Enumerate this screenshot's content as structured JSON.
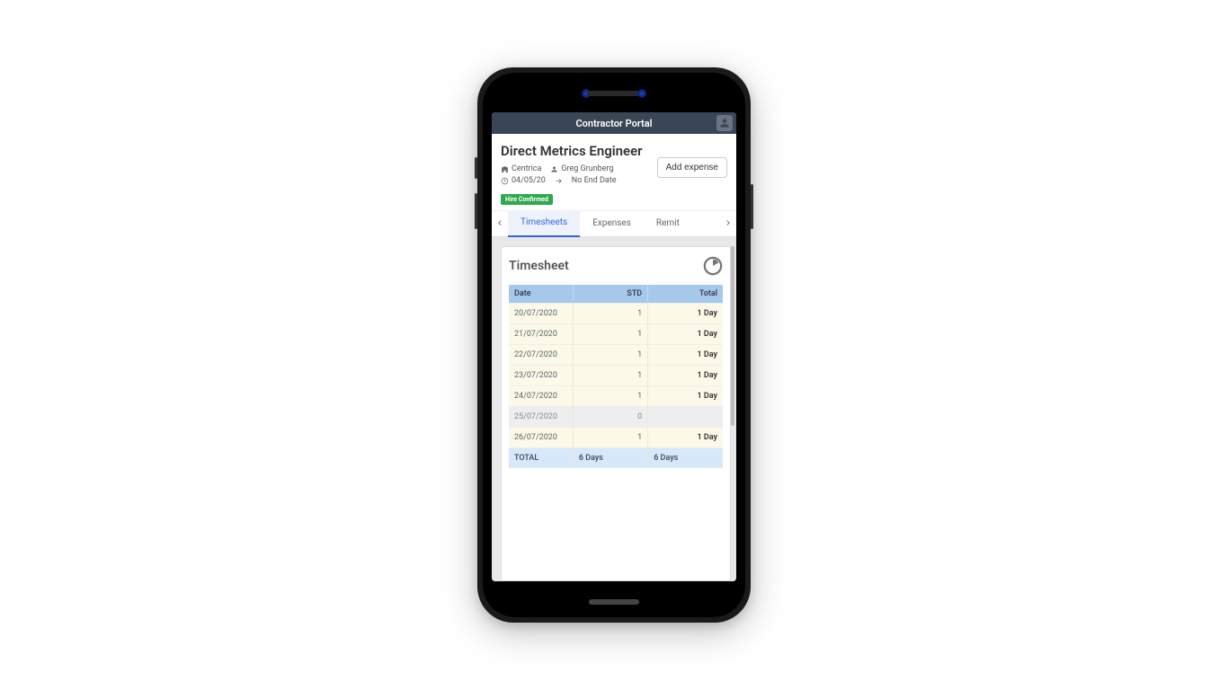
{
  "header": {
    "title": "Contractor Portal"
  },
  "job": {
    "title": "Direct Metrics Engineer",
    "company": "Centrica",
    "contractor": "Greg Grunberg",
    "start_date": "04/05/20",
    "end_date": "No End Date",
    "status_badge": "Hire Confirmed",
    "add_expense_label": "Add expense"
  },
  "tabs": {
    "items": [
      "Timesheets",
      "Expenses",
      "Remit"
    ],
    "active_index": 0
  },
  "timesheet": {
    "card_title": "Timesheet",
    "columns": {
      "date": "Date",
      "std": "STD",
      "total": "Total"
    },
    "rows": [
      {
        "date": "20/07/2020",
        "std": "1",
        "total": "1 Day",
        "zero": false
      },
      {
        "date": "21/07/2020",
        "std": "1",
        "total": "1 Day",
        "zero": false
      },
      {
        "date": "22/07/2020",
        "std": "1",
        "total": "1 Day",
        "zero": false
      },
      {
        "date": "23/07/2020",
        "std": "1",
        "total": "1 Day",
        "zero": false
      },
      {
        "date": "24/07/2020",
        "std": "1",
        "total": "1 Day",
        "zero": false
      },
      {
        "date": "25/07/2020",
        "std": "0",
        "total": "",
        "zero": true
      },
      {
        "date": "26/07/2020",
        "std": "1",
        "total": "1 Day",
        "zero": false
      }
    ],
    "footer": {
      "label": "TOTAL",
      "std": "6 Days",
      "total": "6 Days"
    }
  }
}
